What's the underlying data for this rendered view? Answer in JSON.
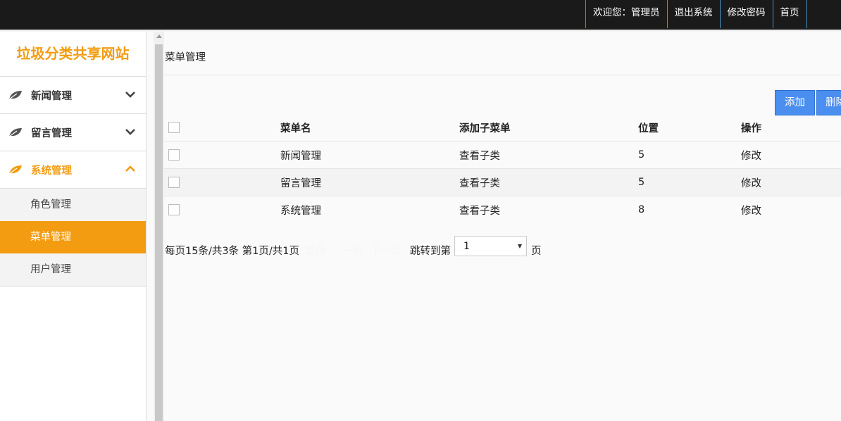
{
  "header": {
    "welcome": "欢迎您：管理员",
    "logout": "退出系统",
    "change_password": "修改密码",
    "home": "首页"
  },
  "sidebar": {
    "site_title": "垃圾分类共享网站",
    "menus": [
      {
        "label": "新闻管理",
        "icon": "leaf-icon",
        "expanded": false
      },
      {
        "label": "留言管理",
        "icon": "leaf-icon",
        "expanded": false
      },
      {
        "label": "系统管理",
        "icon": "leaf-icon",
        "expanded": true
      }
    ],
    "submenu": [
      {
        "label": "角色管理"
      },
      {
        "label": "菜单管理",
        "selected": true
      },
      {
        "label": "用户管理"
      }
    ]
  },
  "breadcrumb": "菜单管理",
  "toolbar": {
    "add": "添加",
    "delete": "删除"
  },
  "table": {
    "headers": [
      "菜单名",
      "添加子菜单",
      "位置",
      "操作"
    ],
    "rows": [
      {
        "name": "新闻管理",
        "child": "查看子类",
        "position": "5",
        "action": "修改"
      },
      {
        "name": "留言管理",
        "child": "查看子类",
        "position": "5",
        "action": "修改"
      },
      {
        "name": "系统管理",
        "child": "查看子类",
        "position": "8",
        "action": "修改"
      }
    ]
  },
  "pager": {
    "summary": "每页15条/共3条 第1页/共1页",
    "first": "首页",
    "prev": "上一页",
    "next": "下一页",
    "last": "尾页",
    "goto_label": "跳转到第",
    "page_select": "1",
    "page_suffix": "页"
  },
  "colors": {
    "accent": "#f39c12",
    "button": "#4a8ef0",
    "topbar": "#1a1a1a"
  }
}
